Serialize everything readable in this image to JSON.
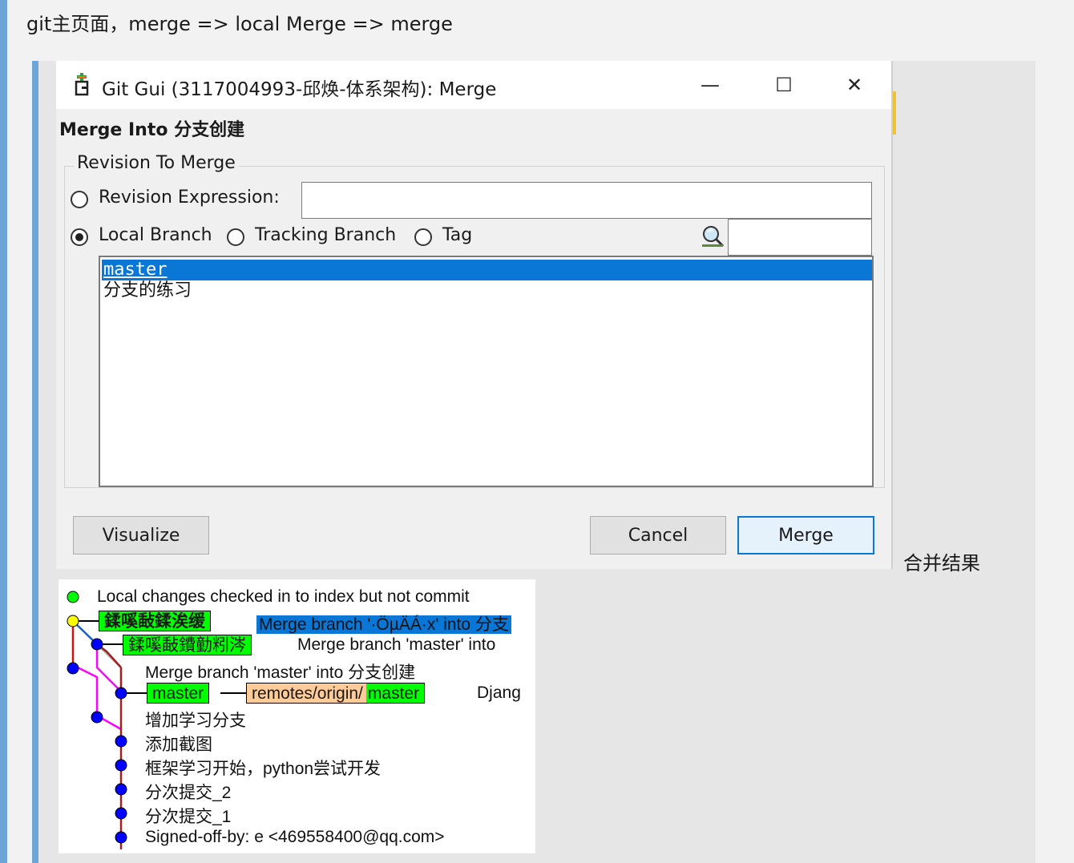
{
  "note": {
    "text": "git主页面，merge => local Merge => merge",
    "result_label": "合并结果"
  },
  "colors": {
    "accent_bar": "#6ca6d8",
    "selection": "#0a76d6",
    "ref_green": "#00ff00",
    "ref_orange": "#ffcc99"
  },
  "window": {
    "title": "Git Gui (3117004993-邱焕-体系架构): Merge",
    "icon": "git-gui-icon",
    "minimize": "—",
    "maximize": "☐",
    "close": "✕"
  },
  "dialog": {
    "heading": "Merge Into 分支创建",
    "group_legend": "Revision To Merge",
    "revision_expression_label": "Revision Expression:",
    "revision_expression_value": "",
    "local_branch_label": "Local Branch",
    "tracking_branch_label": "Tracking Branch",
    "tag_label": "Tag",
    "selected_option": "local_branch",
    "filter_value": "",
    "branches": [
      "master",
      "分支的练习"
    ],
    "selected_branch": "master",
    "buttons": {
      "visualize": "Visualize",
      "cancel": "Cancel",
      "merge": "Merge"
    }
  },
  "history": {
    "commits": [
      {
        "text": "Local changes checked in to index but not commit"
      },
      {
        "refs": [
          "鍒嗘敮鍒涘缓"
        ],
        "text": "Merge branch '·ÖµÄÁ·x' into 分支"
      },
      {
        "refs": [
          "鍒嗘敮鐨勭粌涔"
        ],
        "text": "Merge branch 'master' into"
      },
      {
        "text": "Merge branch 'master' into 分支创建"
      },
      {
        "refs": [
          "master"
        ],
        "remote_prefix": "remotes/origin/",
        "remote_branch": "master",
        "text": "Djang"
      },
      {
        "text": "增加学习分支"
      },
      {
        "text": "添加截图"
      },
      {
        "text": "框架学习开始，python尝试开发"
      },
      {
        "text": "分次提交_2"
      },
      {
        "text": "分次提交_1"
      },
      {
        "text": "Signed-off-by: e <469558400@qq.com>"
      }
    ]
  }
}
